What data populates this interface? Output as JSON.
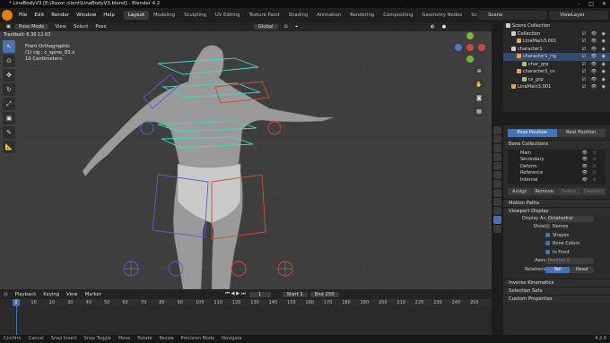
{
  "window": {
    "title": "* LinaBodyV3 [E:\\Razor client\\LinaBodyV3.blend] - Blender 4.2",
    "controls": [
      "–",
      "□",
      "✕"
    ]
  },
  "menus": [
    "File",
    "Edit",
    "Render",
    "Window",
    "Help"
  ],
  "workspaces": [
    "Layout",
    "Modeling",
    "Sculpting",
    "UV Editing",
    "Texture Paint",
    "Shading",
    "Animation",
    "Rendering",
    "Compositing",
    "Geometry Nodes",
    "Scripting"
  ],
  "active_workspace": "Layout",
  "scene": "Scene",
  "view_layer": "ViewLayer",
  "viewport_header": {
    "mode": "Pose Mode",
    "menus": [
      "View",
      "Select",
      "Pose"
    ],
    "orientation": "Global"
  },
  "trackball": "Trackball: 6.30 12.03",
  "viewport_info": {
    "view": "Front Orthographic",
    "object": "(1) rig : c_spine_03.x",
    "scale": "10 Centimeters"
  },
  "outliner": {
    "rows": [
      {
        "label": "Scene Collection",
        "indent": 0,
        "color": "#cfcfcf",
        "selected": false
      },
      {
        "label": "Collection",
        "indent": 1,
        "color": "#cfcfcf",
        "selected": false
      },
      {
        "label": "LinaMain3.001",
        "indent": 2,
        "color": "#e8a44a",
        "selected": false
      },
      {
        "label": "character1",
        "indent": 1,
        "color": "#cfcfcf",
        "selected": false
      },
      {
        "label": "character1_rig",
        "indent": 2,
        "color": "#e8a44a",
        "selected": true
      },
      {
        "label": "char_grp",
        "indent": 3,
        "color": "#9bc46c",
        "selected": false
      },
      {
        "label": "character1_cs",
        "indent": 2,
        "color": "#e8a44a",
        "selected": false
      },
      {
        "label": "cs_grp",
        "indent": 3,
        "color": "#9bc46c",
        "selected": false
      },
      {
        "label": "LinaMain3.001",
        "indent": 1,
        "color": "#e8a44a",
        "selected": false
      }
    ]
  },
  "properties": {
    "pose_position": "Pose Position",
    "rest_position": "Rest Position",
    "bone_collections_title": "Bone Collections",
    "bone_collections": [
      "Main",
      "Secondary",
      "Deform",
      "Reference",
      "Internal"
    ],
    "buttons": [
      "Assign",
      "Remove",
      "Select",
      "Deselect"
    ],
    "motion_paths": "Motion Paths",
    "viewport_display": "Viewport Display",
    "display_as_label": "Display As",
    "display_as": "Octahedral",
    "show_label": "Show",
    "show_options": [
      {
        "label": "Names",
        "checked": false
      },
      {
        "label": "Shapes",
        "checked": true
      },
      {
        "label": "Bone Colors",
        "checked": true
      },
      {
        "label": "In Front",
        "checked": true
      }
    ],
    "axes_label": "Axes",
    "axes_position": "Position",
    "axes_value": "0",
    "relations_label": "Relations",
    "relations": [
      "Tail",
      "Head"
    ],
    "sections": [
      "Inverse Kinematics",
      "Selection Sets",
      "Custom Properties"
    ]
  },
  "timeline": {
    "menus": [
      "Playback",
      "Keying",
      "View",
      "Marker"
    ],
    "current_frame": "1",
    "start_label": "Start",
    "start": "1",
    "end_label": "End",
    "end": "250",
    "ticks": [
      "0",
      "10",
      "20",
      "30",
      "40",
      "50",
      "60",
      "70",
      "80",
      "90",
      "100",
      "110",
      "120",
      "130",
      "140",
      "150",
      "160",
      "170",
      "180",
      "190",
      "200",
      "210",
      "220",
      "230",
      "240",
      "250"
    ]
  },
  "statusbar": [
    "Confirm",
    "Cancel",
    "Snap Invert",
    "Snap Toggle",
    "Move",
    "Rotate",
    "Resize",
    "Precision Mode",
    "Navigate"
  ],
  "version": "4.2.0",
  "colors": {
    "accent": "#4772b3",
    "viewport_bg": "#3e3e3e",
    "rig_blue": "#5b5bd6",
    "rig_red": "#d64b2f",
    "rig_cyan": "#3fd7c7"
  }
}
